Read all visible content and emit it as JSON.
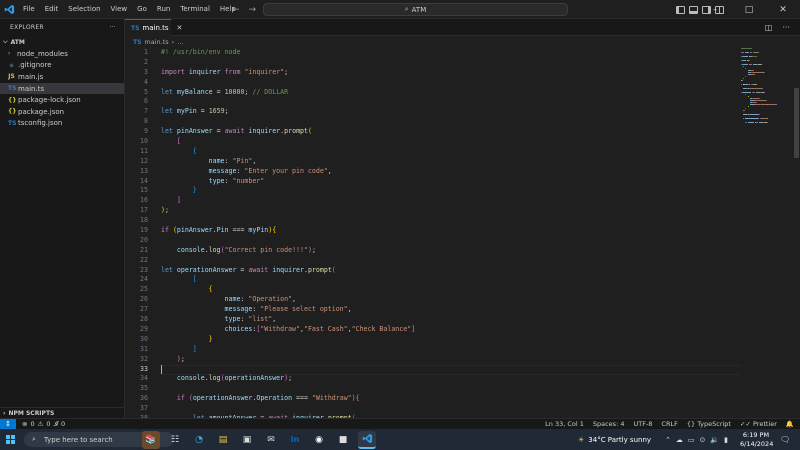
{
  "titlebar": {
    "menu": [
      "File",
      "Edit",
      "Selection",
      "View",
      "Go",
      "Run",
      "Terminal",
      "Help"
    ],
    "search_text": "ATM",
    "back_arrow": "←",
    "forward_arrow": "→",
    "minimize": "–",
    "maximize": "□",
    "close": "✕"
  },
  "sidebar": {
    "title": "EXPLORER",
    "more": "···",
    "folder": "ATM",
    "items": [
      {
        "label": "node_modules",
        "icon": "chevron-right-icon",
        "badge": "›"
      },
      {
        "label": ".gitignore",
        "icon": "git-icon",
        "badge": "◆"
      },
      {
        "label": "main.js",
        "icon": "js-icon",
        "badge": "JS"
      },
      {
        "label": "main.ts",
        "icon": "ts-icon",
        "badge": "TS"
      },
      {
        "label": "package-lock.json",
        "icon": "json-icon",
        "badge": "{}"
      },
      {
        "label": "package.json",
        "icon": "json-icon",
        "badge": "{}"
      },
      {
        "label": "tsconfig.json",
        "icon": "tsconfig-icon",
        "badge": "TS"
      }
    ],
    "npm_scripts": "NPM SCRIPTS"
  },
  "editor": {
    "tab_label": "main.ts",
    "tab_badge": "TS",
    "breadcrumb_file": "main.ts",
    "breadcrumb_sep": "›",
    "breadcrumb_more": "...",
    "current_line": 33
  },
  "statusbar": {
    "errors": "0",
    "warnings": "0",
    "info": "0",
    "position": "Ln 33, Col 1",
    "spaces": "Spaces: 4",
    "encoding": "UTF-8",
    "eol": "CRLF",
    "language": "TypeScript",
    "prettier": "Prettier"
  },
  "taskbar": {
    "search_placeholder": "Type here to search",
    "weather": "34°C  Partly sunny",
    "time": "6:19 PM",
    "date": "6/14/2024"
  },
  "colors": {
    "accent": "#0078d4",
    "keyword": "#569cd6",
    "string": "#ce9178",
    "variable": "#9cdcfe",
    "function": "#dcdcaa",
    "number": "#b5cea8",
    "comment": "#6a9955"
  },
  "code_lines": [
    [
      [
        "c",
        "#! /usr/bin/env node"
      ]
    ],
    [],
    [
      [
        "kc",
        "import"
      ],
      [
        "p",
        " "
      ],
      [
        "v",
        "inquirer"
      ],
      [
        "p",
        " "
      ],
      [
        "kc",
        "from"
      ],
      [
        "p",
        " "
      ],
      [
        "s",
        "\"inquirer\""
      ],
      [
        "p",
        ";"
      ]
    ],
    [],
    [
      [
        "k",
        "let"
      ],
      [
        "p",
        " "
      ],
      [
        "v",
        "myBalance"
      ],
      [
        "p",
        " = "
      ],
      [
        "n",
        "10000"
      ],
      [
        "p",
        "; "
      ],
      [
        "c",
        "// DOLLAR"
      ]
    ],
    [],
    [
      [
        "k",
        "let"
      ],
      [
        "p",
        " "
      ],
      [
        "v",
        "myPin"
      ],
      [
        "p",
        " = "
      ],
      [
        "n",
        "1659"
      ],
      [
        "p",
        ";"
      ]
    ],
    [],
    [
      [
        "k",
        "let"
      ],
      [
        "p",
        " "
      ],
      [
        "v",
        "pinAnswer"
      ],
      [
        "p",
        " = "
      ],
      [
        "kc",
        "await"
      ],
      [
        "p",
        " "
      ],
      [
        "v",
        "inquirer"
      ],
      [
        "p",
        "."
      ],
      [
        "f",
        "prompt"
      ],
      [
        "b1",
        "("
      ]
    ],
    [
      [
        "p",
        "    "
      ],
      [
        "b2",
        "["
      ]
    ],
    [
      [
        "p",
        "        "
      ],
      [
        "b3",
        "{"
      ]
    ],
    [
      [
        "p",
        "            "
      ],
      [
        "v",
        "name"
      ],
      [
        "p",
        ": "
      ],
      [
        "s",
        "\"Pin\""
      ],
      [
        "p",
        ","
      ]
    ],
    [
      [
        "p",
        "            "
      ],
      [
        "v",
        "message"
      ],
      [
        "p",
        ": "
      ],
      [
        "s",
        "\"Enter your pin code\""
      ],
      [
        "p",
        ","
      ]
    ],
    [
      [
        "p",
        "            "
      ],
      [
        "v",
        "type"
      ],
      [
        "p",
        ": "
      ],
      [
        "s",
        "\"number\""
      ]
    ],
    [
      [
        "p",
        "        "
      ],
      [
        "b3",
        "}"
      ]
    ],
    [
      [
        "p",
        "    "
      ],
      [
        "b2",
        "]"
      ]
    ],
    [
      [
        "b1",
        ")"
      ],
      [
        "p",
        ";"
      ]
    ],
    [],
    [
      [
        "kc",
        "if"
      ],
      [
        "p",
        " "
      ],
      [
        "b1",
        "("
      ],
      [
        "v",
        "pinAnswer"
      ],
      [
        "p",
        "."
      ],
      [
        "v",
        "Pin"
      ],
      [
        "p",
        " === "
      ],
      [
        "v",
        "myPin"
      ],
      [
        "b1",
        ")"
      ],
      [
        "b1",
        "{"
      ]
    ],
    [],
    [
      [
        "p",
        "    "
      ],
      [
        "v",
        "console"
      ],
      [
        "p",
        "."
      ],
      [
        "f",
        "log"
      ],
      [
        "b2",
        "("
      ],
      [
        "s",
        "\"Correct pin code!!!\""
      ],
      [
        "b2",
        ")"
      ],
      [
        "p",
        ";"
      ]
    ],
    [],
    [
      [
        "k",
        "let"
      ],
      [
        "p",
        " "
      ],
      [
        "v",
        "operationAnswer"
      ],
      [
        "p",
        " = "
      ],
      [
        "kc",
        "await"
      ],
      [
        "p",
        " "
      ],
      [
        "v",
        "inquirer"
      ],
      [
        "p",
        "."
      ],
      [
        "f",
        "prompt"
      ],
      [
        "b2",
        "("
      ]
    ],
    [
      [
        "p",
        "        "
      ],
      [
        "b3",
        "["
      ]
    ],
    [
      [
        "p",
        "            "
      ],
      [
        "b1",
        "{"
      ]
    ],
    [
      [
        "p",
        "                "
      ],
      [
        "v",
        "name"
      ],
      [
        "p",
        ": "
      ],
      [
        "s",
        "\"Operation\""
      ],
      [
        "p",
        ","
      ]
    ],
    [
      [
        "p",
        "                "
      ],
      [
        "v",
        "message"
      ],
      [
        "p",
        ": "
      ],
      [
        "s",
        "\"Please select option\""
      ],
      [
        "p",
        ","
      ]
    ],
    [
      [
        "p",
        "                "
      ],
      [
        "v",
        "type"
      ],
      [
        "p",
        ": "
      ],
      [
        "s",
        "\"list\""
      ],
      [
        "p",
        ","
      ]
    ],
    [
      [
        "p",
        "                "
      ],
      [
        "v",
        "choices"
      ],
      [
        "p",
        ":"
      ],
      [
        "b2",
        "["
      ],
      [
        "s",
        "\"Withdraw\""
      ],
      [
        "p",
        ","
      ],
      [
        "s",
        "\"Fast Cash\""
      ],
      [
        "p",
        ","
      ],
      [
        "s",
        "\"Check Balance\""
      ],
      [
        "b2",
        "]"
      ]
    ],
    [
      [
        "p",
        "            "
      ],
      [
        "b1",
        "}"
      ]
    ],
    [
      [
        "p",
        "        "
      ],
      [
        "b3",
        "]"
      ]
    ],
    [
      [
        "p",
        "    "
      ],
      [
        "b2",
        ")"
      ],
      [
        "p",
        ";"
      ]
    ],
    [],
    [
      [
        "p",
        "    "
      ],
      [
        "v",
        "console"
      ],
      [
        "p",
        "."
      ],
      [
        "f",
        "log"
      ],
      [
        "b2",
        "("
      ],
      [
        "v",
        "operationAnswer"
      ],
      [
        "b2",
        ")"
      ],
      [
        "p",
        ";"
      ]
    ],
    [],
    [
      [
        "p",
        "    "
      ],
      [
        "kc",
        "if"
      ],
      [
        "p",
        " "
      ],
      [
        "b2",
        "("
      ],
      [
        "v",
        "operationAnswer"
      ],
      [
        "p",
        "."
      ],
      [
        "v",
        "Operation"
      ],
      [
        "p",
        " === "
      ],
      [
        "s",
        "\"Withdraw\""
      ],
      [
        "b2",
        ")"
      ],
      [
        "b2",
        "{"
      ]
    ],
    [],
    [
      [
        "p",
        "        "
      ],
      [
        "k",
        "let"
      ],
      [
        "p",
        " "
      ],
      [
        "v",
        "amountAnswer"
      ],
      [
        "p",
        " = "
      ],
      [
        "kc",
        "await"
      ],
      [
        "p",
        " "
      ],
      [
        "v",
        "inquirer"
      ],
      [
        "p",
        "."
      ],
      [
        "f",
        "prompt"
      ],
      [
        "b3",
        "("
      ]
    ]
  ]
}
